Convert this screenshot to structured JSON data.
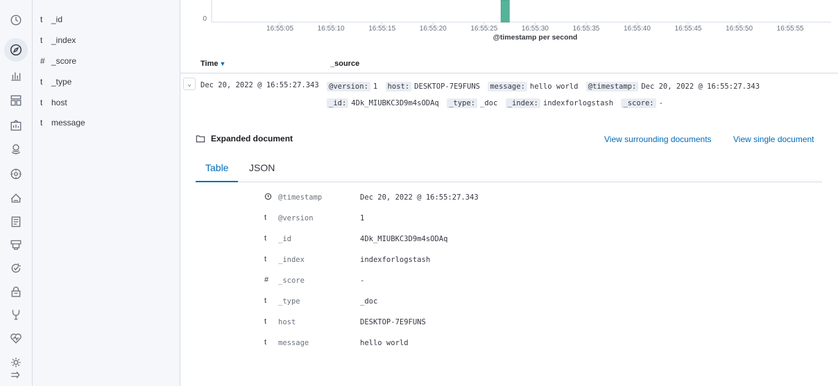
{
  "rail": {
    "icons": [
      "clock-icon",
      "compass-icon",
      "visualize-icon",
      "dashboard-icon",
      "canvas-icon",
      "maps-icon",
      "ml-icon",
      "graph-icon",
      "logs-icon",
      "index-icon",
      "uptime-icon",
      "siem-icon",
      "devtools-icon",
      "monitoring-icon",
      "management-icon",
      "collapse-icon"
    ]
  },
  "fields": [
    {
      "type": "t",
      "name": "_id"
    },
    {
      "type": "t",
      "name": "_index"
    },
    {
      "type": "#",
      "name": "_score"
    },
    {
      "type": "t",
      "name": "_type"
    },
    {
      "type": "t",
      "name": "host"
    },
    {
      "type": "t",
      "name": "message"
    }
  ],
  "chart_data": {
    "type": "bar",
    "xlabel": "@timestamp per second",
    "ylabel": "",
    "ytick_visible": "0",
    "categories": [
      "16:55:05",
      "16:55:10",
      "16:55:15",
      "16:55:20",
      "16:55:25",
      "16:55:30",
      "16:55:35",
      "16:55:40",
      "16:55:45",
      "16:55:50",
      "16:55:55"
    ],
    "bars": [
      {
        "x": "16:55:27",
        "value": 1
      }
    ],
    "color": "#54b399"
  },
  "table": {
    "time_header": "Time",
    "source_header": "_source"
  },
  "doc": {
    "timestamp": "Dec 20, 2022 @ 16:55:27.343",
    "source_line1": [
      {
        "k": "@version:",
        "v": "1"
      },
      {
        "k": "host:",
        "v": "DESKTOP-7E9FUNS"
      },
      {
        "k": "message:",
        "v": "hello world"
      },
      {
        "k": "@timestamp:",
        "v": "Dec 20, 2022 @ 16:55:27.343"
      }
    ],
    "source_line2": [
      {
        "k": "_id:",
        "v": "4Dk_MIUBKC3D9m4sODAq"
      },
      {
        "k": "_type:",
        "v": "_doc"
      },
      {
        "k": "_index:",
        "v": "indexforlogstash"
      },
      {
        "k": "_score:",
        "v": "-"
      }
    ]
  },
  "expanded": {
    "title": "Expanded document",
    "link_surrounding": "View surrounding documents",
    "link_single": "View single document",
    "tab_table": "Table",
    "tab_json": "JSON",
    "rows": [
      {
        "type": "clock",
        "name": "@timestamp",
        "value": "Dec 20, 2022 @ 16:55:27.343"
      },
      {
        "type": "t",
        "name": "@version",
        "value": "1"
      },
      {
        "type": "t",
        "name": "_id",
        "value": "4Dk_MIUBKC3D9m4sODAq"
      },
      {
        "type": "t",
        "name": "_index",
        "value": "indexforlogstash"
      },
      {
        "type": "#",
        "name": "_score",
        "value": "-"
      },
      {
        "type": "t",
        "name": "_type",
        "value": "_doc"
      },
      {
        "type": "t",
        "name": "host",
        "value": "DESKTOP-7E9FUNS"
      },
      {
        "type": "t",
        "name": "message",
        "value": "hello world"
      }
    ]
  }
}
